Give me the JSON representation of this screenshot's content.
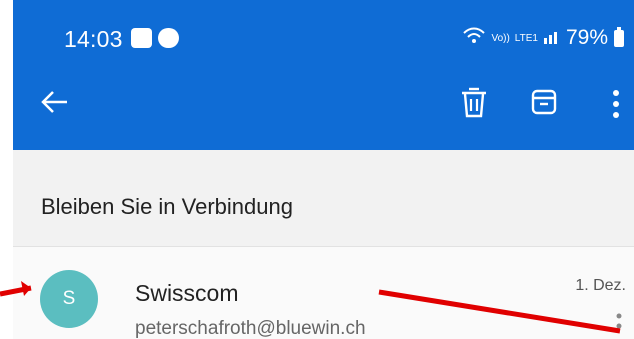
{
  "status_bar": {
    "time": "14:03",
    "battery": "79%",
    "volte": "Vo))",
    "lte": "LTE1"
  },
  "header": {
    "back_icon": "arrow-left-icon",
    "delete_icon": "trash-icon",
    "archive_icon": "archive-icon",
    "more_icon": "more-vert-icon"
  },
  "thread": {
    "subject": "Bleiben Sie in Verbindung"
  },
  "message": {
    "avatar_letter": "S",
    "sender_name": "Swisscom",
    "sender_email": "peterschafroth@bluewin.ch",
    "date": "1. Dez."
  },
  "colors": {
    "appbar": "#0f6cd5",
    "avatar": "#5bbec0",
    "annotation_arrow": "#e00000"
  }
}
